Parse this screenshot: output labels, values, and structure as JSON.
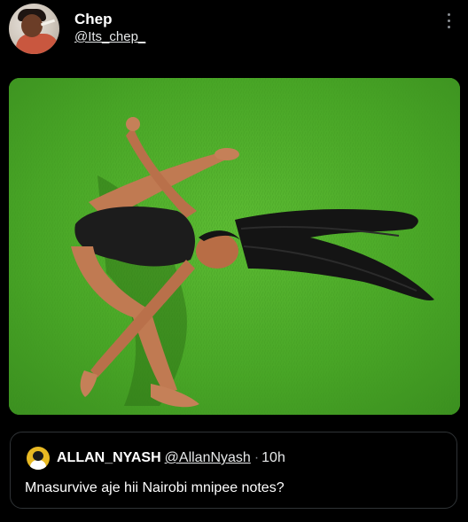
{
  "post": {
    "author": {
      "display_name": "Chep",
      "handle": "@Its_chep_"
    },
    "more_icon": "more-vertical-icon"
  },
  "media": {
    "kind": "photo",
    "subject": "woman-lying-on-grass"
  },
  "quoted_post": {
    "author_name": "ALLAN_NYASH",
    "author_handle": "@AllanNyash",
    "separator": "·",
    "time": "10h",
    "text": "Mnasurvive aje hii Nairobi mnipee notes?"
  },
  "colors": {
    "background": "#000000",
    "text": "#ffffff",
    "muted": "#8b8f94",
    "border": "#2f3336",
    "grass": "#4caa2a"
  }
}
